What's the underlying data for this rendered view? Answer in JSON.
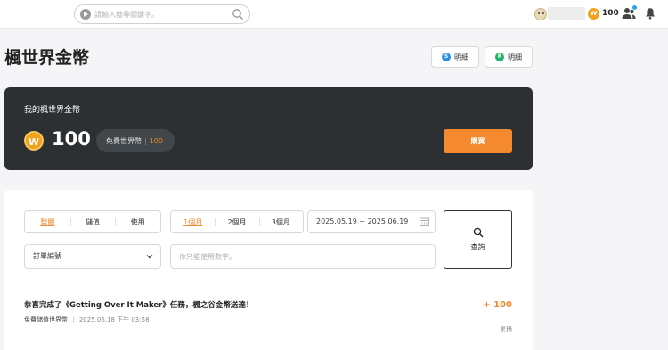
{
  "topbar": {
    "search_placeholder": "請輸入搜尋關鍵字。",
    "coin_symbol": "W",
    "coin_balance": "100"
  },
  "page": {
    "title": "楓世界金幣",
    "detail_buttons": [
      {
        "icon_letter": "S",
        "label": "明細",
        "color": "#2e8fe0"
      },
      {
        "icon_letter": "R",
        "label": "明細",
        "color": "#21b36b"
      }
    ]
  },
  "wallet": {
    "label": "我的楓世界金幣",
    "coin_symbol": "W",
    "balance": "100",
    "free_label": "免費世界幣",
    "free_value": "100",
    "buy_label": "購買"
  },
  "filters": {
    "type_options": [
      "整體",
      "儲值",
      "使用"
    ],
    "type_active": "整體",
    "period_options": [
      "1個月",
      "2個月",
      "3個月"
    ],
    "period_active": "1個月",
    "date_range": "2025.05.19 ~ 2025.06.19",
    "query_label": "查詢",
    "select_value": "訂單編號",
    "number_placeholder": "你只能使用數字。"
  },
  "transactions": [
    {
      "title": "恭喜完成了《Getting Over It Maker》任務，楓之谷金幣送達！",
      "type": "免費儲值世界幣",
      "timestamp": "2025.06.18 下午 03:58",
      "amount": "+ 100",
      "status": "累積"
    }
  ],
  "colors": {
    "accent": "#f08a2c",
    "dark_card": "#2d3033",
    "coin": "#f2a21a"
  }
}
